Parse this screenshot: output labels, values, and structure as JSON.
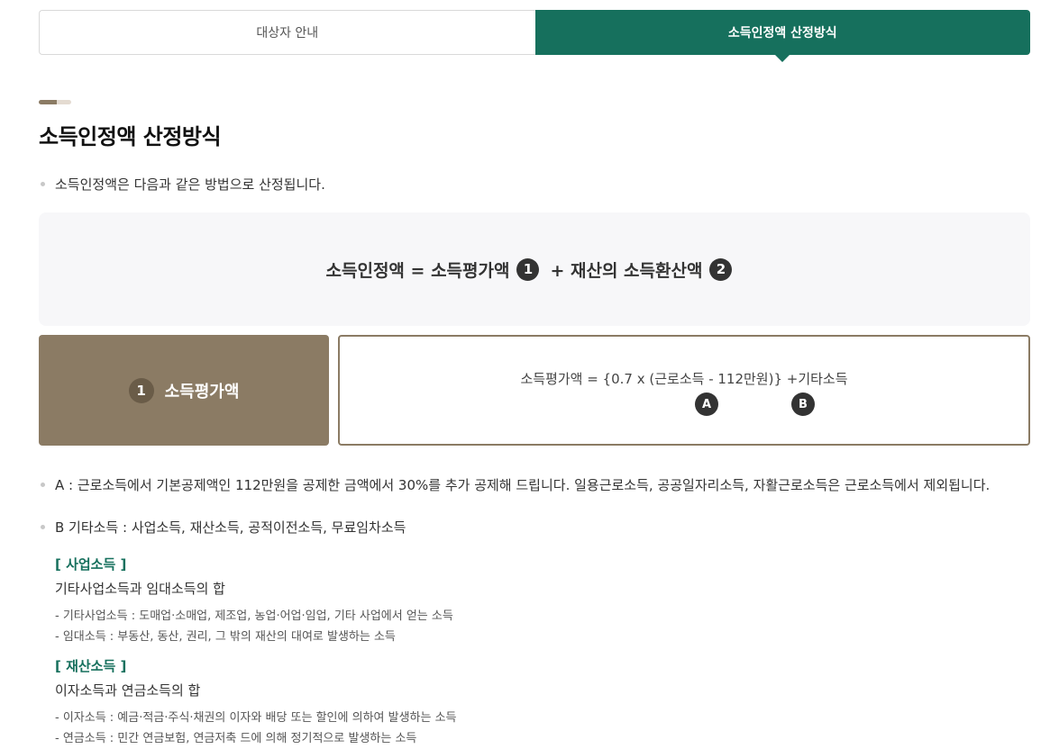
{
  "tabs": [
    {
      "label": "대상자 안내",
      "active": false
    },
    {
      "label": "소득인정액 산정방식",
      "active": true
    }
  ],
  "page_title": "소득인정액 산정방식",
  "intro": "소득인정액은 다음과 같은 방법으로 산정됩니다.",
  "formula": {
    "part1": "소득인정액 = 소득평가액",
    "num1": "1",
    "part2": "+ 재산의 소득환산액",
    "num2": "2"
  },
  "card": {
    "num": "1",
    "label": "소득평가액",
    "equation": "소득평가액 = {0.7 x (근로소득 - 112만원)} +기타소득",
    "marker_a": "A",
    "marker_b": "B"
  },
  "notes": {
    "a": "A : 근로소득에서 기본공제액인 112만원을 공제한 금액에서 30%를 추가 공제해 드립니다. 일용근로소득, 공공일자리소득, 자활근로소득은 근로소득에서 제외됩니다.",
    "b": "B 기타소득 : 사업소득, 재산소득, 공적이전소득, 무료임차소득"
  },
  "business": {
    "heading": "[ 사업소득 ]",
    "summary": "기타사업소득과 임대소득의 합",
    "items": [
      "-  기타사업소득 : 도매업·소매업, 제조업, 농업·어업·임업, 기타 사업에서 얻는 소득",
      "-  임대소득 : 부동산, 동산, 권리, 그 밖의 재산의 대여로 발생하는 소득"
    ]
  },
  "property": {
    "heading": "[ 재산소득 ]",
    "summary": "이자소득과 연금소득의 합",
    "items": [
      "-  이자소득 : 예금·적금·주식·채권의 이자와 배당 또는 할인에 의하여 발생하는 소득",
      "-  연금소득 : 민간 연금보험, 연금저축 드에 의해 정기적으로 발생하는 소득"
    ]
  }
}
